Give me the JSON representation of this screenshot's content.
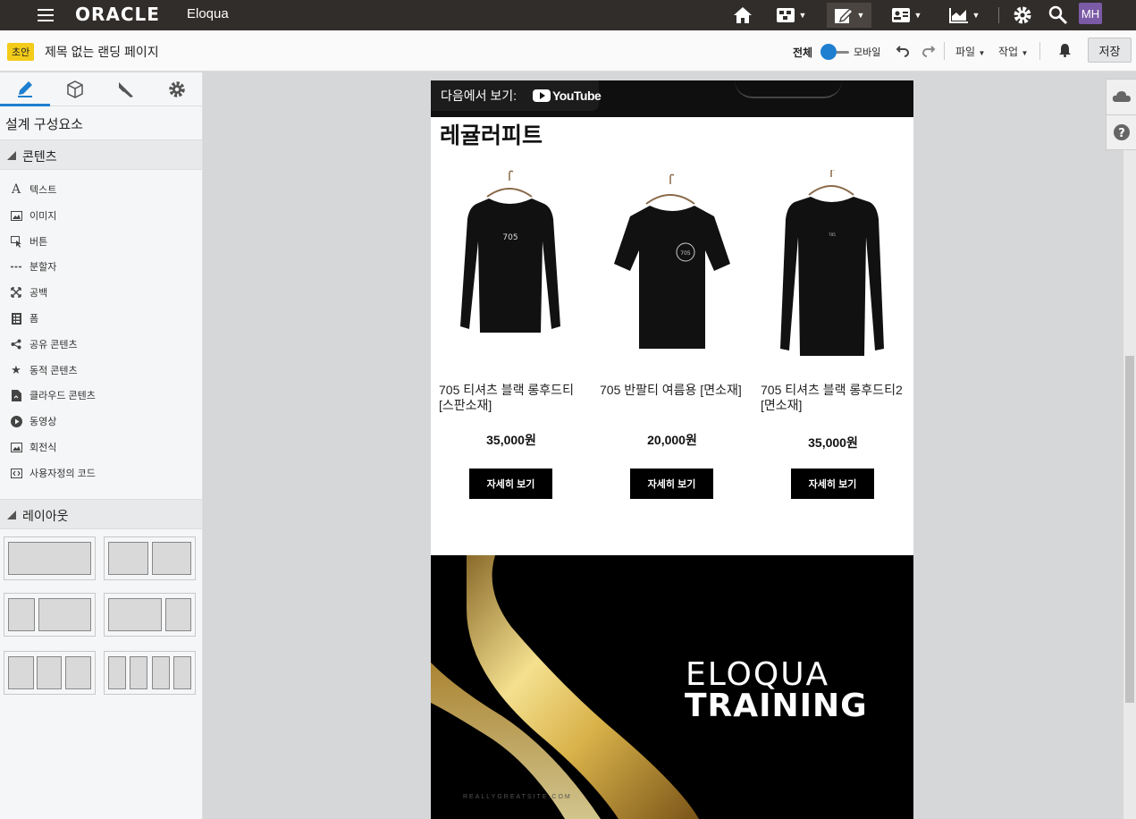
{
  "topbar": {
    "brand": "ORACLE",
    "app_name": "Eloqua",
    "avatar_initials": "MH",
    "icons": [
      "home-icon",
      "campaign-icon",
      "edit-icon",
      "contacts-icon",
      "analytics-icon",
      "gear-icon",
      "search-icon"
    ]
  },
  "toolbar2": {
    "status_badge": "초안",
    "page_name": "제목 없는 랜딩 페이지",
    "view_all": "전체",
    "view_mobile": "모바일",
    "menu_file": "파일",
    "menu_action": "작업",
    "save_label": "저장",
    "accent_color": "#1e7fd0"
  },
  "leftpanel": {
    "title": "설계 구성요소",
    "tabs": [
      "design-tab",
      "components-tab",
      "style-tab",
      "settings-tab"
    ],
    "content_section": "콘텐츠",
    "content_items": [
      {
        "label": "텍스트",
        "icon": "text-icon"
      },
      {
        "label": "이미지",
        "icon": "image-icon"
      },
      {
        "label": "버튼",
        "icon": "button-icon"
      },
      {
        "label": "분할자",
        "icon": "divider-icon"
      },
      {
        "label": "공백",
        "icon": "spacer-icon"
      },
      {
        "label": "폼",
        "icon": "form-icon"
      },
      {
        "label": "공유 콘텐츠",
        "icon": "share-icon"
      },
      {
        "label": "동적 콘텐츠",
        "icon": "star-icon"
      },
      {
        "label": "클라우드 콘텐츠",
        "icon": "cloud-content-icon"
      },
      {
        "label": "동영상",
        "icon": "play-icon"
      },
      {
        "label": "회전식",
        "icon": "carousel-icon"
      },
      {
        "label": "사용자정의 코드",
        "icon": "code-icon"
      }
    ],
    "layout_section": "레이아웃"
  },
  "canvas": {
    "youtube_watch_on": "다음에서 보기:",
    "youtube_brand": "YouTube",
    "section_title": "레귤러피트",
    "products": [
      {
        "name": "705 티셔츠 블랙 롱후드티  [스판소재]",
        "price": "35,000원",
        "button": "자세히 보기",
        "shirt_text": "705"
      },
      {
        "name": "705 반팔티 여름용 [면소재]",
        "price": "20,000원",
        "button": "자세히 보기",
        "shirt_text": "705"
      },
      {
        "name": "705 티셔츠 블랙 롱후드티2 [면소재]",
        "price": "35,000원",
        "button": "자세히 보기",
        "shirt_text": "705"
      }
    ],
    "banner": {
      "line1": "ELOQUA",
      "line2": "TRAINING",
      "url": "REALLYGREATSITE.COM",
      "ribbon_color": "#d4af37"
    }
  }
}
